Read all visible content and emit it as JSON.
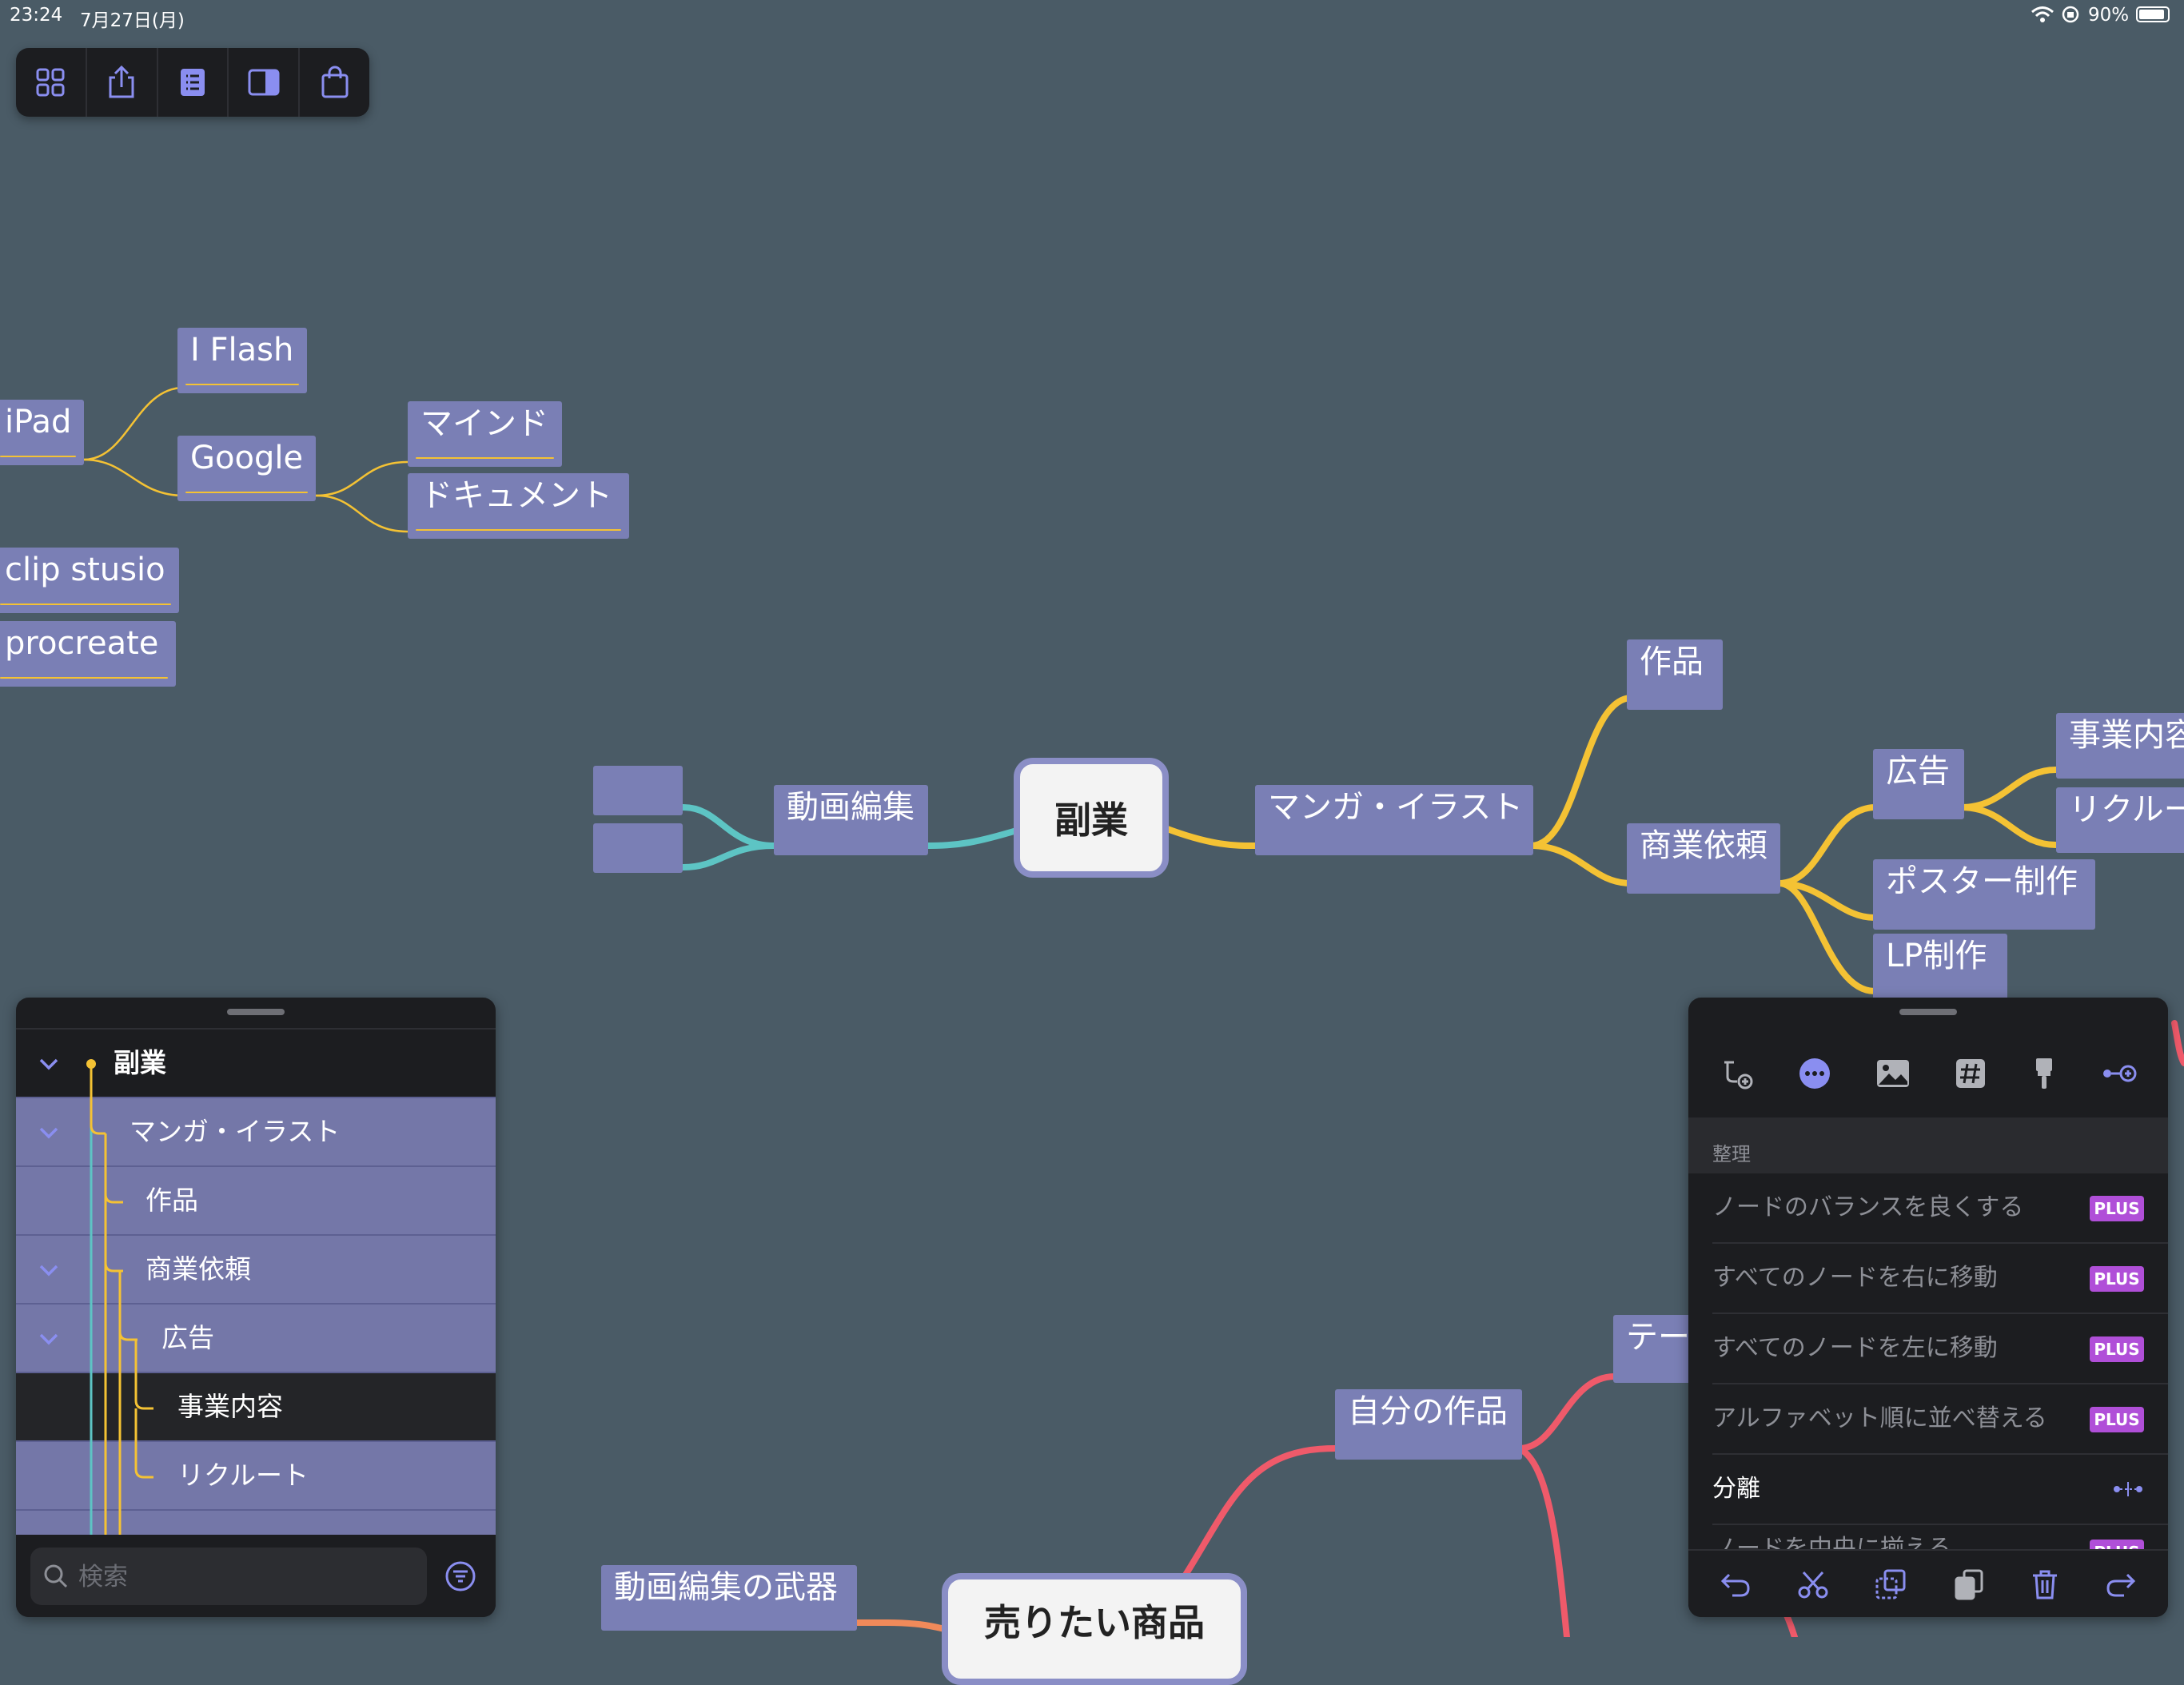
{
  "status_bar": {
    "time": "23:24",
    "date": "7月27日(月)",
    "battery": "90%"
  },
  "toolbar": {
    "buttons": [
      "grid-icon",
      "share-icon",
      "outline-icon",
      "sidebar-icon",
      "store-icon"
    ]
  },
  "mindmap": {
    "root": "副業",
    "root2": "売りたい商品",
    "nodes": {
      "iflash": "I Flash",
      "ipad": "iPad",
      "google": "Google",
      "mind": "マインド",
      "doc": "ドキュメント",
      "clip": "clip stusio",
      "procreate": "procreate",
      "douga": "動画編集",
      "blank1": "",
      "blank2": "",
      "manga": "マンガ・イラスト",
      "sakuhin": "作品",
      "shogyo": "商業依頼",
      "kokoku": "広告",
      "jigyo": "事業内容",
      "recruit": "リクルート",
      "poster": "ポスター制作",
      "lp": "LP制作",
      "jibun": "自分の作品",
      "theme": "テー",
      "buki": "動画編集の武器"
    },
    "branch_colors": {
      "yellow": "#f4c234",
      "teal": "#5dc4c4",
      "red": "#ef5a6a",
      "orange": "#f08a5a"
    }
  },
  "outline": {
    "rows": [
      {
        "label": "副業",
        "expanded": true
      },
      {
        "label": "マンガ・イラスト",
        "expanded": true
      },
      {
        "label": "作品"
      },
      {
        "label": "商業依頼",
        "expanded": true
      },
      {
        "label": "広告",
        "expanded": true
      },
      {
        "label": "事業内容"
      },
      {
        "label": "リクルート"
      }
    ],
    "search_placeholder": "検索"
  },
  "format_panel": {
    "tabs": [
      "branch-add-icon",
      "more-icon",
      "image-icon",
      "tag-icon",
      "brush-icon",
      "connect-icon"
    ],
    "section": "整理",
    "items": [
      {
        "label": "ノードのバランスを良くする",
        "badge": "PLUS"
      },
      {
        "label": "すべてのノードを右に移動",
        "badge": "PLUS"
      },
      {
        "label": "すべてのノードを左に移動",
        "badge": "PLUS"
      },
      {
        "label": "アルファベット順に並べ替える",
        "badge": "PLUS"
      },
      {
        "label": "分離"
      },
      {
        "label": "ノードを中央に揃える",
        "badge": "PLUS"
      }
    ],
    "bottom_actions": [
      "undo-icon",
      "cut-icon",
      "copy-icon",
      "paste-icon",
      "delete-icon",
      "redo-icon"
    ]
  }
}
